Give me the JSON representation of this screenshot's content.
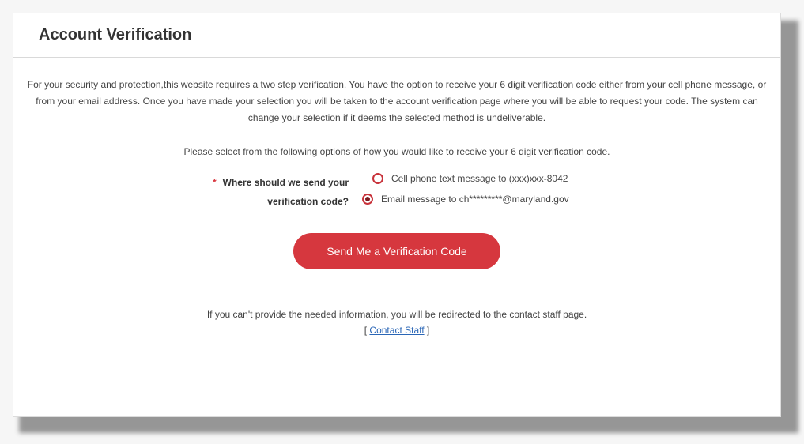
{
  "header": {
    "title": "Account Verification"
  },
  "body": {
    "intro": "For your security and protection,this website requires a two step verification. You have the option to receive your 6 digit verification code either from your cell phone message, or from your email address. Once you have made your selection you will be taken to the account verification page where you will be able to request your code. The system can change your selection if it deems the selected method is undeliverable.",
    "prompt": "Please select from the following options of how you would like to receive your 6 digit verification code.",
    "question": {
      "required_marker": "*",
      "label": "Where should we send your verification code?"
    },
    "options": [
      {
        "label": "Cell phone text message to (xxx)xxx-8042",
        "selected": false
      },
      {
        "label": "Email message to ch*********@maryland.gov",
        "selected": true
      }
    ],
    "send_button_label": "Send Me a Verification Code",
    "footer_note": "If you can't provide the needed information, you will be redirected to the contact staff page.",
    "contact": {
      "open_bracket": "[",
      "link_label": "Contact Staff",
      "close_bracket": "]"
    }
  },
  "colors": {
    "accent": "#d6373e",
    "link": "#2a66b6"
  }
}
